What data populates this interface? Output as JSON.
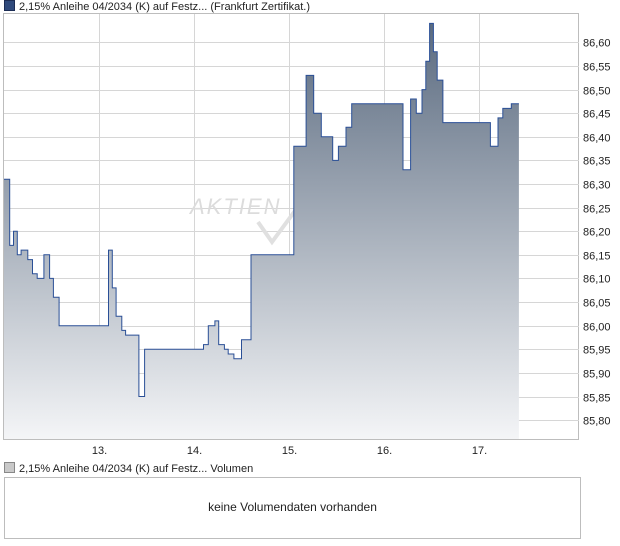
{
  "legend": {
    "price_label": "2,15% Anleihe 04/2034 (K) auf Festz... (Frankfurt Zertifikat.)",
    "volume_label": "2,15% Anleihe 04/2034 (K) auf Festz... Volumen"
  },
  "volume_panel": {
    "message": "keine Volumendaten vorhanden"
  },
  "watermark": "AKTIEN",
  "colors": {
    "line": "#2a4f96",
    "fill_top": "#5b6b80",
    "fill_bottom": "#f4f5f7",
    "grid": "#d6d6d6",
    "frame": "#bdbdbd"
  },
  "chart_data": {
    "type": "area",
    "title": "",
    "xlabel": "",
    "ylabel": "",
    "x_ticks": [
      "13.",
      "14.",
      "15.",
      "16.",
      "17."
    ],
    "ylim": [
      85.76,
      86.66
    ],
    "y_ticks": [
      85.8,
      85.85,
      85.9,
      85.95,
      86.0,
      86.05,
      86.1,
      86.15,
      86.2,
      86.25,
      86.3,
      86.35,
      86.4,
      86.45,
      86.5,
      86.55,
      86.6
    ],
    "y_tick_labels": [
      "85,80",
      "85,85",
      "85,90",
      "85,95",
      "86,00",
      "86,05",
      "86,10",
      "86,15",
      "86,20",
      "86,25",
      "86,30",
      "86,35",
      "86,40",
      "86,45",
      "86,50",
      "86,55",
      "86,60"
    ],
    "grid": true,
    "series": [
      {
        "x": [
          12.0,
          12.06,
          12.06,
          12.1,
          12.1,
          12.14,
          12.14,
          12.18,
          12.18,
          12.25,
          12.25,
          12.3,
          12.3,
          12.35,
          12.35,
          12.42,
          12.42,
          12.48,
          12.48,
          12.52,
          12.52,
          12.58,
          12.58,
          13.1,
          13.1,
          13.14,
          13.14,
          13.18,
          13.18,
          13.24,
          13.24,
          13.28,
          13.28,
          13.42,
          13.42,
          13.48,
          13.48,
          14.1,
          14.1,
          14.15,
          14.15,
          14.22,
          14.22,
          14.26,
          14.26,
          14.32,
          14.32,
          14.36,
          14.36,
          14.42,
          14.42,
          14.5,
          14.5,
          14.6,
          14.6,
          15.05,
          15.05,
          15.18,
          15.18,
          15.26,
          15.26,
          15.34,
          15.34,
          15.46,
          15.46,
          15.52,
          15.52,
          15.6,
          15.6,
          15.66,
          15.66,
          16.2,
          16.2,
          16.28,
          16.28,
          16.34,
          16.34,
          16.4,
          16.4,
          16.44,
          16.44,
          16.48,
          16.48,
          16.52,
          16.52,
          16.56,
          16.56,
          16.62,
          16.62,
          16.68,
          16.68,
          16.72,
          16.72,
          16.76,
          16.76,
          16.8,
          16.8,
          16.84,
          16.84,
          17.12,
          17.12,
          17.2,
          17.2,
          17.25,
          17.25,
          17.34,
          17.34,
          17.42
        ],
        "values": [
          86.31,
          86.31,
          86.17,
          86.17,
          86.2,
          86.2,
          86.15,
          86.15,
          86.16,
          86.16,
          86.14,
          86.14,
          86.11,
          86.11,
          86.1,
          86.1,
          86.15,
          86.15,
          86.1,
          86.1,
          86.06,
          86.06,
          86.0,
          86.0,
          86.16,
          86.16,
          86.08,
          86.08,
          86.02,
          86.02,
          85.99,
          85.99,
          85.98,
          85.98,
          85.85,
          85.85,
          85.95,
          85.95,
          85.96,
          85.96,
          86.0,
          86.0,
          86.01,
          86.01,
          85.96,
          85.96,
          85.95,
          85.95,
          85.94,
          85.94,
          85.93,
          85.93,
          85.97,
          85.97,
          86.15,
          86.15,
          86.38,
          86.38,
          86.53,
          86.53,
          86.45,
          86.45,
          86.4,
          86.4,
          86.35,
          86.35,
          86.38,
          86.38,
          86.42,
          86.42,
          86.47,
          86.47,
          86.33,
          86.33,
          86.48,
          86.48,
          86.45,
          86.45,
          86.5,
          86.5,
          86.56,
          86.56,
          86.64,
          86.64,
          86.58,
          86.58,
          86.52,
          86.52,
          86.43,
          86.43,
          86.43,
          86.43,
          86.43,
          86.43,
          86.43,
          86.43,
          86.43,
          86.43,
          86.43,
          86.43,
          86.38,
          86.38,
          86.44,
          86.44,
          86.46,
          86.46,
          86.47,
          86.47
        ]
      }
    ]
  }
}
